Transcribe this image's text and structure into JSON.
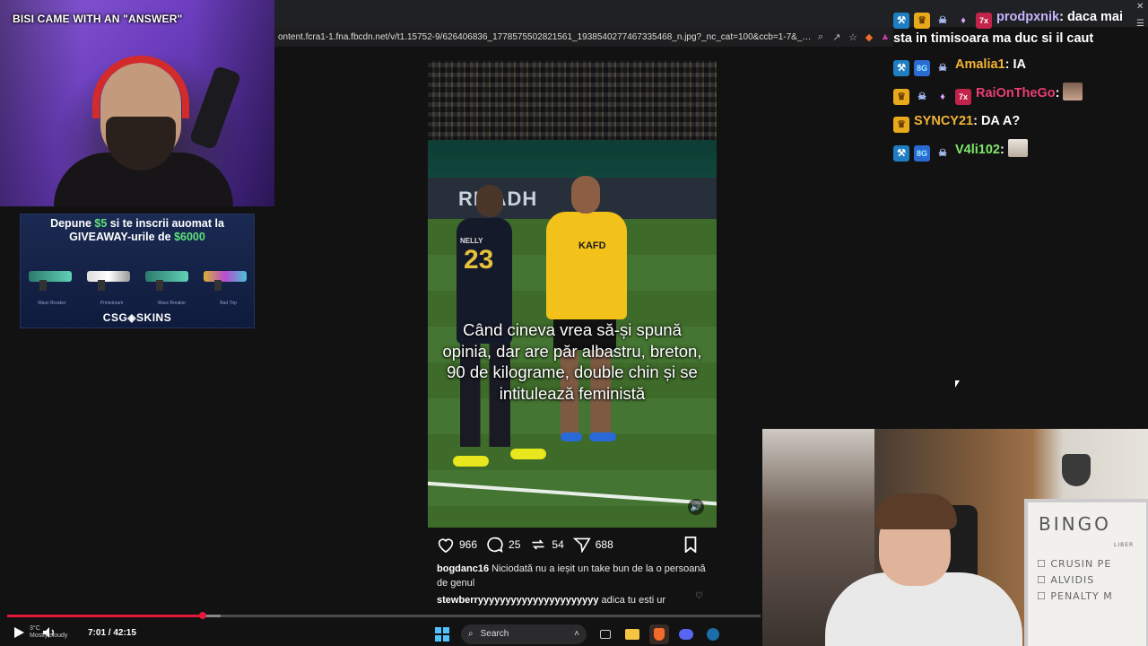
{
  "stream_title": "BISI CAME WITH AN \"ANSWER\"",
  "browser": {
    "url": "ontent.fcra1-1.fna.fbcdn.net/v/t1.15752-9/626406836_1778575502821561_1938540277467335468_n.jpg?_nc_cat=100&ccb=1-7&_nc_sid=fc1..."
  },
  "ad": {
    "line1_prefix": "Depune ",
    "line1_amount": "$5",
    "line1_suffix": " si te inscrii auomat la",
    "line2_prefix": "GIVEAWAY-urile de ",
    "line2_amount": "$6000",
    "skins": [
      "Wave Breaker",
      "Printstream",
      "Wave Breaker",
      "Bad Trip"
    ],
    "brand": "CSG◈SKINS",
    "accent_color": "#5ee07a"
  },
  "post": {
    "board_text": "RIYADH",
    "jersey_name": "NELLY",
    "jersey_number": "23",
    "sponsor": "KAFD",
    "caption": "Când cineva vrea să-și spună opinia, dar are păr albastru, breton, 90 de kilograme, double chin și se intitulează feministă",
    "likes": "966",
    "comments_count": "25",
    "reposts": "54",
    "shares": "688",
    "comments": [
      {
        "user": "bogdanc16",
        "text": "Niciodată nu a ieșit un take bun de la o persoană de genul"
      },
      {
        "user": "stewberryyyyyyyyyyyyyyyyyyyyyy",
        "text": "adica tu esti ur"
      }
    ]
  },
  "chat": [
    {
      "badges": [
        "hammer-icon",
        "crown-icon",
        "ghost-icon",
        "gift-icon",
        "sub-7x-icon"
      ],
      "user": "prodpxnik",
      "user_color": "#c6b3ff",
      "text": "daca mai sta in timisoara ma duc si il caut"
    },
    {
      "badges": [
        "hammer-icon",
        "8g-icon",
        "ghost-icon"
      ],
      "user": "Amalia1",
      "user_color": "#f2b533",
      "text": "IA"
    },
    {
      "badges": [
        "crown-icon",
        "ghost-icon",
        "gift-icon",
        "sub-7x-icon"
      ],
      "user": "RaiOnTheGo",
      "user_color": "#e83f70",
      "text": "",
      "emote": "face"
    },
    {
      "badges": [
        "crown-icon"
      ],
      "user": "SYNCY21",
      "user_color": "#f2b533",
      "text": "DA A?"
    },
    {
      "badges": [
        "hammer-icon",
        "8g-icon",
        "ghost-icon"
      ],
      "user": "V4li102",
      "user_color": "#7ee86a",
      "text": "",
      "emote": "cat"
    }
  ],
  "whiteboard": {
    "title": "BINGO",
    "lines": [
      "☐ CRUSIN PE",
      "☐ ALVIDIS",
      "☐ PENALTY M"
    ],
    "corner": "LIBER"
  },
  "player": {
    "time": "7:01 / 42:15",
    "progress": 0.2595,
    "buffered": 0.2835,
    "weather_temp": "3°C",
    "weather_desc": "Mostly cloudy"
  },
  "taskbar": {
    "search_label": "Search"
  }
}
